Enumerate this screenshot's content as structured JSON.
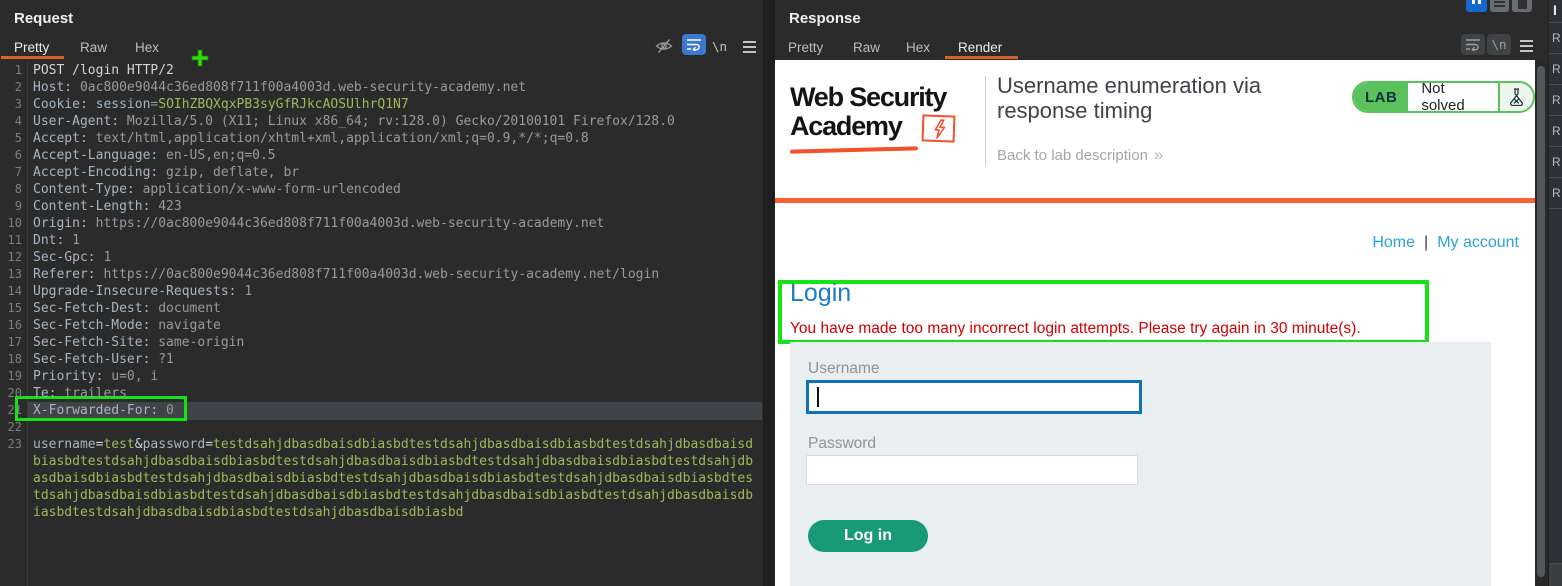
{
  "colors": {
    "burp_background": "#2b2b2b",
    "tab_accent_orange": "#d9622b",
    "annotation_green": "#16e316",
    "code_param_green": "#9cba59",
    "code_header_name": "#a6b5c4",
    "portswigger_orange": "#ff6232",
    "link_blue": "#29a3dd",
    "heading_blue": "#1a7cc4",
    "warning_red": "#d40000",
    "button_teal": "#18997a",
    "lab_badge_green": "#5ac25c",
    "input_focus_blue": "#0f73ba"
  },
  "request_panel": {
    "title": "Request",
    "tabs": [
      {
        "label": "Pretty",
        "active": true
      },
      {
        "label": "Raw",
        "active": false
      },
      {
        "label": "Hex",
        "active": false
      }
    ],
    "icons": [
      "hide-soft-newlines-icon",
      "word-wrap-icon",
      "show-newlines-icon",
      "menu-icon"
    ],
    "newline_glyph": "\\n",
    "lines": [
      {
        "n": 1,
        "parts": [
          [
            "w",
            "POST /login HTTP/2"
          ]
        ]
      },
      {
        "n": 2,
        "parts": [
          [
            "h",
            "Host:"
          ],
          [
            "v",
            " 0ac800e9044c36ed808f711f00a4003d.web-security-academy.net"
          ]
        ]
      },
      {
        "n": 3,
        "parts": [
          [
            "h",
            "Cookie:"
          ],
          [
            "v",
            " "
          ],
          [
            "h",
            "session"
          ],
          [
            "v",
            "="
          ],
          [
            "g",
            "SOIhZBQXqxPB3syGfRJkcAOSUlhrQ1N7"
          ]
        ]
      },
      {
        "n": 4,
        "parts": [
          [
            "h",
            "User-Agent:"
          ],
          [
            "v",
            " Mozilla/5.0 (X11; Linux x86_64; rv:128.0) Gecko/20100101 Firefox/128.0"
          ]
        ]
      },
      {
        "n": 5,
        "parts": [
          [
            "h",
            "Accept:"
          ],
          [
            "v",
            " text/html,application/xhtml+xml,application/xml;q=0.9,*/*;q=0.8"
          ]
        ]
      },
      {
        "n": 6,
        "parts": [
          [
            "h",
            "Accept-Language:"
          ],
          [
            "v",
            " en-US,en;q=0.5"
          ]
        ]
      },
      {
        "n": 7,
        "parts": [
          [
            "h",
            "Accept-Encoding:"
          ],
          [
            "v",
            " gzip, deflate, br"
          ]
        ]
      },
      {
        "n": 8,
        "parts": [
          [
            "h",
            "Content-Type:"
          ],
          [
            "v",
            " application/x-www-form-urlencoded"
          ]
        ]
      },
      {
        "n": 9,
        "parts": [
          [
            "h",
            "Content-Length:"
          ],
          [
            "v",
            " 423"
          ]
        ]
      },
      {
        "n": 10,
        "parts": [
          [
            "h",
            "Origin:"
          ],
          [
            "v",
            " https://0ac800e9044c36ed808f711f00a4003d.web-security-academy.net"
          ]
        ]
      },
      {
        "n": 11,
        "parts": [
          [
            "h",
            "Dnt:"
          ],
          [
            "v",
            " 1"
          ]
        ]
      },
      {
        "n": 12,
        "parts": [
          [
            "h",
            "Sec-Gpc:"
          ],
          [
            "v",
            " 1"
          ]
        ]
      },
      {
        "n": 13,
        "parts": [
          [
            "h",
            "Referer:"
          ],
          [
            "v",
            " https://0ac800e9044c36ed808f711f00a4003d.web-security-academy.net/login"
          ]
        ]
      },
      {
        "n": 14,
        "parts": [
          [
            "h",
            "Upgrade-Insecure-Requests:"
          ],
          [
            "v",
            " 1"
          ]
        ]
      },
      {
        "n": 15,
        "parts": [
          [
            "h",
            "Sec-Fetch-Dest:"
          ],
          [
            "v",
            " document"
          ]
        ]
      },
      {
        "n": 16,
        "parts": [
          [
            "h",
            "Sec-Fetch-Mode:"
          ],
          [
            "v",
            " navigate"
          ]
        ]
      },
      {
        "n": 17,
        "parts": [
          [
            "h",
            "Sec-Fetch-Site:"
          ],
          [
            "v",
            " same-origin"
          ]
        ]
      },
      {
        "n": 18,
        "parts": [
          [
            "h",
            "Sec-Fetch-User:"
          ],
          [
            "v",
            " ?1"
          ]
        ]
      },
      {
        "n": 19,
        "parts": [
          [
            "h",
            "Priority:"
          ],
          [
            "v",
            " u=0, i"
          ]
        ]
      },
      {
        "n": 20,
        "parts": [
          [
            "h",
            "Te:"
          ],
          [
            "v",
            " trailers"
          ]
        ]
      },
      {
        "n": 21,
        "hl": true,
        "parts": [
          [
            "h",
            "X-Forwarded-For:"
          ],
          [
            "v",
            " 0"
          ]
        ]
      },
      {
        "n": 22,
        "parts": []
      },
      {
        "n": 23,
        "parts": [
          [
            "h",
            "username"
          ],
          [
            "w",
            "="
          ],
          [
            "g",
            "test"
          ],
          [
            "w",
            "&"
          ],
          [
            "h",
            "password"
          ],
          [
            "w",
            "="
          ],
          [
            "g",
            "testdsahjdbasdbaisdbiasbd",
            16
          ]
        ]
      }
    ]
  },
  "response_panel": {
    "title": "Response",
    "tabs": [
      {
        "label": "Pretty",
        "active": false
      },
      {
        "label": "Raw",
        "active": false
      },
      {
        "label": "Hex",
        "active": false
      },
      {
        "label": "Render",
        "active": true
      }
    ],
    "icons": [
      "word-wrap-icon",
      "show-newlines-icon",
      "menu-icon"
    ],
    "newline_glyph": "\\n",
    "layout_buttons": [
      "pause-button",
      "rows-layout-button",
      "pane-layout-button"
    ]
  },
  "rendered_page": {
    "logo_line1": "Web Security",
    "logo_line2": "Academy",
    "lab_title": "Username enumeration via response timing",
    "back_link": "Back to lab description",
    "back_chevrons": "»",
    "lab_badge": {
      "label": "LAB",
      "status": "Not solved"
    },
    "nav": {
      "home": "Home",
      "separator": "|",
      "my_account": "My account"
    },
    "login": {
      "heading": "Login",
      "warning": "You have made too many incorrect login attempts. Please try again in 30 minute(s).",
      "username_label": "Username",
      "username_value": "",
      "password_label": "Password",
      "password_value": "",
      "submit_label": "Log in"
    }
  },
  "inspector": {
    "collapsed_labels": [
      "I",
      "R",
      "R",
      "R",
      "R",
      "R",
      "R"
    ]
  }
}
